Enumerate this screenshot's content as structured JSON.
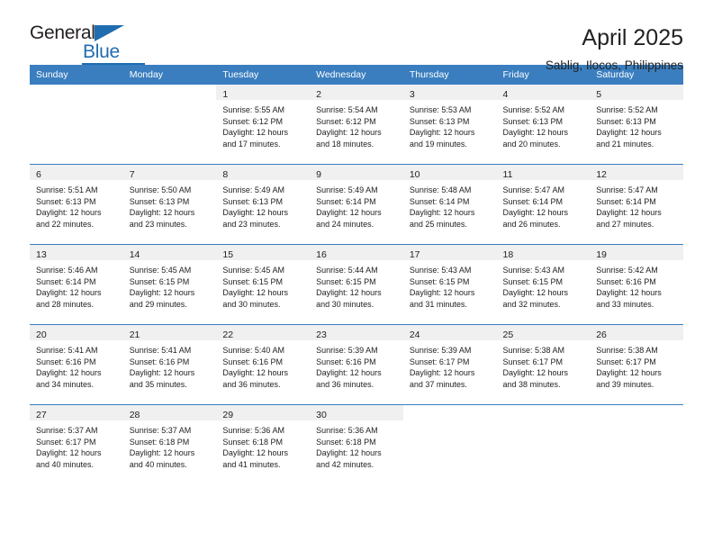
{
  "brand": {
    "name_part1": "General",
    "name_part2": "Blue",
    "triangle_icon": "triangle-icon",
    "accent_color": "#1f6cb0"
  },
  "header": {
    "title": "April 2025",
    "subtitle": "Sablig, Ilocos, Philippines"
  },
  "calendar": {
    "header_bg": "#3a7ebf",
    "daynum_band_bg": "#f0f0f0",
    "row_divider_color": "#3a7ebf",
    "weekdays": [
      "Sunday",
      "Monday",
      "Tuesday",
      "Wednesday",
      "Thursday",
      "Friday",
      "Saturday"
    ],
    "weeks": [
      [
        {
          "day": "",
          "lines": []
        },
        {
          "day": "",
          "lines": []
        },
        {
          "day": "1",
          "lines": [
            "Sunrise: 5:55 AM",
            "Sunset: 6:12 PM",
            "Daylight: 12 hours",
            "and 17 minutes."
          ]
        },
        {
          "day": "2",
          "lines": [
            "Sunrise: 5:54 AM",
            "Sunset: 6:12 PM",
            "Daylight: 12 hours",
            "and 18 minutes."
          ]
        },
        {
          "day": "3",
          "lines": [
            "Sunrise: 5:53 AM",
            "Sunset: 6:13 PM",
            "Daylight: 12 hours",
            "and 19 minutes."
          ]
        },
        {
          "day": "4",
          "lines": [
            "Sunrise: 5:52 AM",
            "Sunset: 6:13 PM",
            "Daylight: 12 hours",
            "and 20 minutes."
          ]
        },
        {
          "day": "5",
          "lines": [
            "Sunrise: 5:52 AM",
            "Sunset: 6:13 PM",
            "Daylight: 12 hours",
            "and 21 minutes."
          ]
        }
      ],
      [
        {
          "day": "6",
          "lines": [
            "Sunrise: 5:51 AM",
            "Sunset: 6:13 PM",
            "Daylight: 12 hours",
            "and 22 minutes."
          ]
        },
        {
          "day": "7",
          "lines": [
            "Sunrise: 5:50 AM",
            "Sunset: 6:13 PM",
            "Daylight: 12 hours",
            "and 23 minutes."
          ]
        },
        {
          "day": "8",
          "lines": [
            "Sunrise: 5:49 AM",
            "Sunset: 6:13 PM",
            "Daylight: 12 hours",
            "and 23 minutes."
          ]
        },
        {
          "day": "9",
          "lines": [
            "Sunrise: 5:49 AM",
            "Sunset: 6:14 PM",
            "Daylight: 12 hours",
            "and 24 minutes."
          ]
        },
        {
          "day": "10",
          "lines": [
            "Sunrise: 5:48 AM",
            "Sunset: 6:14 PM",
            "Daylight: 12 hours",
            "and 25 minutes."
          ]
        },
        {
          "day": "11",
          "lines": [
            "Sunrise: 5:47 AM",
            "Sunset: 6:14 PM",
            "Daylight: 12 hours",
            "and 26 minutes."
          ]
        },
        {
          "day": "12",
          "lines": [
            "Sunrise: 5:47 AM",
            "Sunset: 6:14 PM",
            "Daylight: 12 hours",
            "and 27 minutes."
          ]
        }
      ],
      [
        {
          "day": "13",
          "lines": [
            "Sunrise: 5:46 AM",
            "Sunset: 6:14 PM",
            "Daylight: 12 hours",
            "and 28 minutes."
          ]
        },
        {
          "day": "14",
          "lines": [
            "Sunrise: 5:45 AM",
            "Sunset: 6:15 PM",
            "Daylight: 12 hours",
            "and 29 minutes."
          ]
        },
        {
          "day": "15",
          "lines": [
            "Sunrise: 5:45 AM",
            "Sunset: 6:15 PM",
            "Daylight: 12 hours",
            "and 30 minutes."
          ]
        },
        {
          "day": "16",
          "lines": [
            "Sunrise: 5:44 AM",
            "Sunset: 6:15 PM",
            "Daylight: 12 hours",
            "and 30 minutes."
          ]
        },
        {
          "day": "17",
          "lines": [
            "Sunrise: 5:43 AM",
            "Sunset: 6:15 PM",
            "Daylight: 12 hours",
            "and 31 minutes."
          ]
        },
        {
          "day": "18",
          "lines": [
            "Sunrise: 5:43 AM",
            "Sunset: 6:15 PM",
            "Daylight: 12 hours",
            "and 32 minutes."
          ]
        },
        {
          "day": "19",
          "lines": [
            "Sunrise: 5:42 AM",
            "Sunset: 6:16 PM",
            "Daylight: 12 hours",
            "and 33 minutes."
          ]
        }
      ],
      [
        {
          "day": "20",
          "lines": [
            "Sunrise: 5:41 AM",
            "Sunset: 6:16 PM",
            "Daylight: 12 hours",
            "and 34 minutes."
          ]
        },
        {
          "day": "21",
          "lines": [
            "Sunrise: 5:41 AM",
            "Sunset: 6:16 PM",
            "Daylight: 12 hours",
            "and 35 minutes."
          ]
        },
        {
          "day": "22",
          "lines": [
            "Sunrise: 5:40 AM",
            "Sunset: 6:16 PM",
            "Daylight: 12 hours",
            "and 36 minutes."
          ]
        },
        {
          "day": "23",
          "lines": [
            "Sunrise: 5:39 AM",
            "Sunset: 6:16 PM",
            "Daylight: 12 hours",
            "and 36 minutes."
          ]
        },
        {
          "day": "24",
          "lines": [
            "Sunrise: 5:39 AM",
            "Sunset: 6:17 PM",
            "Daylight: 12 hours",
            "and 37 minutes."
          ]
        },
        {
          "day": "25",
          "lines": [
            "Sunrise: 5:38 AM",
            "Sunset: 6:17 PM",
            "Daylight: 12 hours",
            "and 38 minutes."
          ]
        },
        {
          "day": "26",
          "lines": [
            "Sunrise: 5:38 AM",
            "Sunset: 6:17 PM",
            "Daylight: 12 hours",
            "and 39 minutes."
          ]
        }
      ],
      [
        {
          "day": "27",
          "lines": [
            "Sunrise: 5:37 AM",
            "Sunset: 6:17 PM",
            "Daylight: 12 hours",
            "and 40 minutes."
          ]
        },
        {
          "day": "28",
          "lines": [
            "Sunrise: 5:37 AM",
            "Sunset: 6:18 PM",
            "Daylight: 12 hours",
            "and 40 minutes."
          ]
        },
        {
          "day": "29",
          "lines": [
            "Sunrise: 5:36 AM",
            "Sunset: 6:18 PM",
            "Daylight: 12 hours",
            "and 41 minutes."
          ]
        },
        {
          "day": "30",
          "lines": [
            "Sunrise: 5:36 AM",
            "Sunset: 6:18 PM",
            "Daylight: 12 hours",
            "and 42 minutes."
          ]
        },
        {
          "day": "",
          "lines": []
        },
        {
          "day": "",
          "lines": []
        },
        {
          "day": "",
          "lines": []
        }
      ]
    ]
  }
}
